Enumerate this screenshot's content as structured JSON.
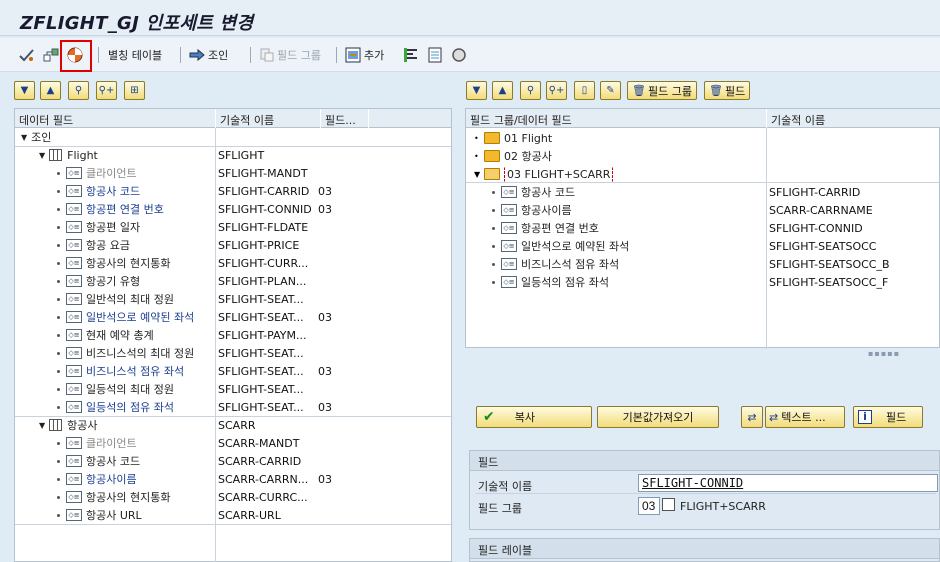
{
  "window": {
    "title": "ZFLIGHT_GJ 인포세트 변경"
  },
  "toolbar": {
    "items": [
      {
        "name": "check-icon"
      },
      {
        "name": "hierarchy-icon"
      },
      {
        "name": "display-change-icon"
      }
    ],
    "alias_table_label": "별칭 테이블",
    "join_label": "조인",
    "field_group_label": "필드 그룹",
    "add_label": "추가"
  },
  "left": {
    "col_headers": [
      "데이터 필드",
      "기술적 이름",
      "필드..."
    ],
    "rows": [
      {
        "level": 0,
        "type": "node",
        "label": "조인",
        "tech": "",
        "num": ""
      },
      {
        "level": 1,
        "type": "table",
        "label": "Flight",
        "tech": "SFLIGHT",
        "num": ""
      },
      {
        "level": 2,
        "type": "field",
        "label": "클라이언트",
        "tech": "SFLIGHT-MANDT",
        "num": "",
        "style": "gray"
      },
      {
        "level": 2,
        "type": "field",
        "label": "항공사 코드",
        "tech": "SFLIGHT-CARRID",
        "num": "03",
        "style": "blue"
      },
      {
        "level": 2,
        "type": "field",
        "label": "항공편 연결 번호",
        "tech": "SFLIGHT-CONNID",
        "num": "03",
        "style": "blue"
      },
      {
        "level": 2,
        "type": "field",
        "label": "항공편 일자",
        "tech": "SFLIGHT-FLDATE",
        "num": "",
        "style": "fld"
      },
      {
        "level": 2,
        "type": "field",
        "label": "항공 요금",
        "tech": "SFLIGHT-PRICE",
        "num": "",
        "style": "fld"
      },
      {
        "level": 2,
        "type": "field",
        "label": "항공사의 현지통화",
        "tech": "SFLIGHT-CURR...",
        "num": "",
        "style": "fld"
      },
      {
        "level": 2,
        "type": "field",
        "label": "항공기 유형",
        "tech": "SFLIGHT-PLAN...",
        "num": "",
        "style": "fld"
      },
      {
        "level": 2,
        "type": "field",
        "label": "일반석의 최대 정원",
        "tech": "SFLIGHT-SEAT...",
        "num": "",
        "style": "fld"
      },
      {
        "level": 2,
        "type": "field",
        "label": "일반석으로 예약된 좌석",
        "tech": "SFLIGHT-SEAT...",
        "num": "03",
        "style": "blue"
      },
      {
        "level": 2,
        "type": "field",
        "label": "현재 예약 총계",
        "tech": "SFLIGHT-PAYM...",
        "num": "",
        "style": "fld"
      },
      {
        "level": 2,
        "type": "field",
        "label": "비즈니스석의 최대 정원",
        "tech": "SFLIGHT-SEAT...",
        "num": "",
        "style": "fld"
      },
      {
        "level": 2,
        "type": "field",
        "label": "비즈니스석 점유 좌석",
        "tech": "SFLIGHT-SEAT...",
        "num": "03",
        "style": "blue"
      },
      {
        "level": 2,
        "type": "field",
        "label": "일등석의 최대 정원",
        "tech": "SFLIGHT-SEAT...",
        "num": "",
        "style": "fld"
      },
      {
        "level": 2,
        "type": "field",
        "label": "일등석의 점유 좌석",
        "tech": "SFLIGHT-SEAT...",
        "num": "03",
        "style": "blue"
      },
      {
        "level": 1,
        "type": "table",
        "label": "항공사",
        "tech": "SCARR",
        "num": ""
      },
      {
        "level": 2,
        "type": "field",
        "label": "클라이언트",
        "tech": "SCARR-MANDT",
        "num": "",
        "style": "gray"
      },
      {
        "level": 2,
        "type": "field",
        "label": "항공사 코드",
        "tech": "SCARR-CARRID",
        "num": "",
        "style": "fld"
      },
      {
        "level": 2,
        "type": "field",
        "label": "항공사이름",
        "tech": "SCARR-CARRN...",
        "num": "03",
        "style": "blue"
      },
      {
        "level": 2,
        "type": "field",
        "label": "항공사의 현지통화",
        "tech": "SCARR-CURRC...",
        "num": "",
        "style": "fld"
      },
      {
        "level": 2,
        "type": "field",
        "label": "항공사 URL",
        "tech": "SCARR-URL",
        "num": "",
        "style": "fld"
      }
    ]
  },
  "right": {
    "toolbar": {
      "field_group_label": "필드 그룹",
      "field_label": "필드"
    },
    "col_headers": [
      "필드 그룹/데이터 필드",
      "기술적 이름"
    ],
    "groups": [
      {
        "label": "01 Flight",
        "open": false
      },
      {
        "label": "02 항공사",
        "open": false
      },
      {
        "label": "03 FLIGHT+SCARR",
        "open": true
      }
    ],
    "fields": [
      {
        "label": "항공사 코드",
        "tech": "SFLIGHT-CARRID"
      },
      {
        "label": "항공사이름",
        "tech": "SCARR-CARRNAME"
      },
      {
        "label": "항공편 연결 번호",
        "tech": "SFLIGHT-CONNID"
      },
      {
        "label": "일반석으로 예약된 좌석",
        "tech": "SFLIGHT-SEATSOCC"
      },
      {
        "label": "비즈니스석 점유 좌석",
        "tech": "SFLIGHT-SEATSOCC_B"
      },
      {
        "label": "일등석의 점유 좌석",
        "tech": "SFLIGHT-SEATSOCC_F"
      }
    ]
  },
  "actions": {
    "copy_label": "복사",
    "fetch_default_label": "기본값가져오기",
    "text_label": "텍스트 ...",
    "field_label": "필드"
  },
  "field_section": {
    "title": "필드",
    "tech_name_label": "기술적 이름",
    "tech_name_value": "SFLIGHT-CONNID",
    "field_group_label": "필드 그룹",
    "field_group_code": "03",
    "field_group_name": "FLIGHT+SCARR"
  },
  "field_label_section": {
    "title": "필드 레이블"
  },
  "colors": {
    "accent": "#1b3f8f",
    "highlight_border": "#e00000",
    "button": "#f2dc7a"
  }
}
